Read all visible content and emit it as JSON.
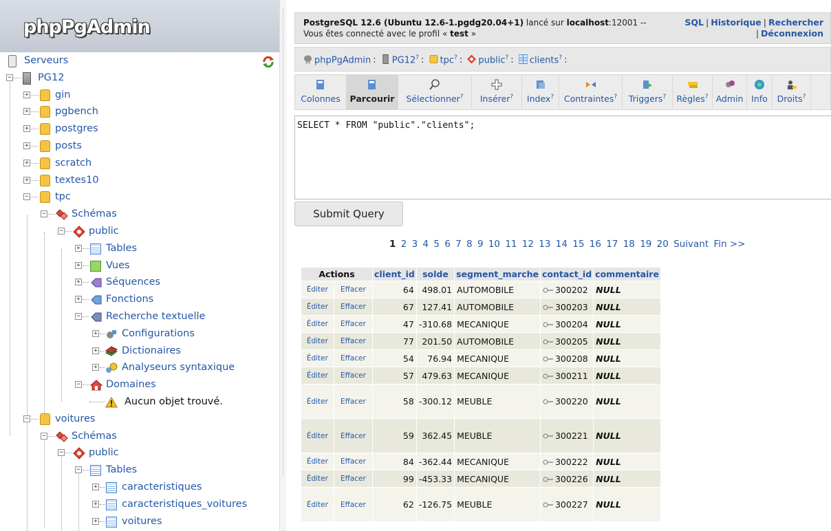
{
  "logo": "phpPgAdmin",
  "tree": {
    "servers": "Serveurs",
    "server": "PG12",
    "databases": [
      "gin",
      "pgbench",
      "postgres",
      "posts",
      "scratch",
      "textes10",
      "tpc",
      "voitures"
    ],
    "tpc": {
      "schemas": "Schémas",
      "public": "public",
      "tables": "Tables",
      "views": "Vues",
      "sequences": "Séquences",
      "functions": "Fonctions",
      "fts": "Recherche textuelle",
      "configs": "Configurations",
      "dictionaries": "Dictionaires",
      "parsers": "Analyseurs syntaxique",
      "domains": "Domaines",
      "empty": "Aucun objet trouvé."
    },
    "voitures": {
      "schemas": "Schémas",
      "public": "public",
      "tables": "Tables",
      "table_items": [
        "caracteristiques",
        "caracteristiques_voitures",
        "voitures"
      ]
    }
  },
  "topbar": {
    "server_version": "PostgreSQL 12.6 (Ubuntu 12.6-1.pgdg20.04+1)",
    "on_text": " lancé sur ",
    "host": "localhost",
    "port_text": ":12001 -- Vous êtes connecté avec le profil « ",
    "user": "test",
    "end_text": " »",
    "links": {
      "sql": "SQL",
      "history": "Historique",
      "search": "Rechercher",
      "logout": "Déconnexion"
    }
  },
  "breadcrumb": {
    "app": "phpPgAdmin",
    "server": "PG12",
    "database": "tpc",
    "schema": "public",
    "table": "clients",
    "q": "?"
  },
  "tabs": [
    {
      "label": "Colonnes",
      "help": ""
    },
    {
      "label": "Parcourir",
      "help": ""
    },
    {
      "label": "Sélectionner",
      "help": "?"
    },
    {
      "label": "Insérer",
      "help": "?"
    },
    {
      "label": "Index",
      "help": "?"
    },
    {
      "label": "Contraintes",
      "help": "?"
    },
    {
      "label": "Triggers",
      "help": "?"
    },
    {
      "label": "Règles",
      "help": "?"
    },
    {
      "label": "Admin",
      "help": ""
    },
    {
      "label": "Info",
      "help": ""
    },
    {
      "label": "Droits",
      "help": "?"
    }
  ],
  "query": "SELECT * FROM \"public\".\"clients\";",
  "submit_label": "Submit Query",
  "pager": {
    "current": "1",
    "pages": [
      "2",
      "3",
      "4",
      "5",
      "6",
      "7",
      "8",
      "9",
      "10",
      "11",
      "12",
      "13",
      "14",
      "15",
      "16",
      "17",
      "18",
      "19",
      "20"
    ],
    "next": "Suivant",
    "last": "Fin >>"
  },
  "table": {
    "headers": {
      "actions": "Actions",
      "client_id": "client_id",
      "solde": "solde",
      "segment": "segment_marche",
      "contact": "contact_id",
      "comment": "commentaire"
    },
    "edit_label": "Éditer",
    "delete_label": "Effacer",
    "rows": [
      {
        "client_id": "64",
        "solde": "498.01",
        "segment": "AUTOMOBILE",
        "contact": "300202",
        "comment": "NULL",
        "tall": false
      },
      {
        "client_id": "67",
        "solde": "127.41",
        "segment": "AUTOMOBILE",
        "contact": "300203",
        "comment": "NULL",
        "tall": false
      },
      {
        "client_id": "47",
        "solde": "-310.68",
        "segment": "MECANIQUE",
        "contact": "300204",
        "comment": "NULL",
        "tall": false
      },
      {
        "client_id": "77",
        "solde": "201.50",
        "segment": "AUTOMOBILE",
        "contact": "300205",
        "comment": "NULL",
        "tall": false
      },
      {
        "client_id": "54",
        "solde": "76.94",
        "segment": "MECANIQUE",
        "contact": "300208",
        "comment": "NULL",
        "tall": false
      },
      {
        "client_id": "57",
        "solde": "479.63",
        "segment": "MECANIQUE",
        "contact": "300211",
        "comment": "NULL",
        "tall": false
      },
      {
        "client_id": "58",
        "solde": "-300.12",
        "segment": "MEUBLE",
        "contact": "300220",
        "comment": "NULL",
        "tall": true
      },
      {
        "client_id": "59",
        "solde": "362.45",
        "segment": "MEUBLE",
        "contact": "300221",
        "comment": "NULL",
        "tall": true
      },
      {
        "client_id": "84",
        "solde": "-362.44",
        "segment": "MECANIQUE",
        "contact": "300222",
        "comment": "NULL",
        "tall": false
      },
      {
        "client_id": "99",
        "solde": "-453.33",
        "segment": "MECANIQUE",
        "contact": "300226",
        "comment": "NULL",
        "tall": false
      },
      {
        "client_id": "62",
        "solde": "-126.75",
        "segment": "MEUBLE",
        "contact": "300227",
        "comment": "NULL",
        "tall": true
      }
    ]
  },
  "colors": {
    "link": "#2457a6",
    "row_light": "#f4f4ed",
    "row_dark": "#e8e8dc",
    "header_bg": "#e5e5e5"
  }
}
